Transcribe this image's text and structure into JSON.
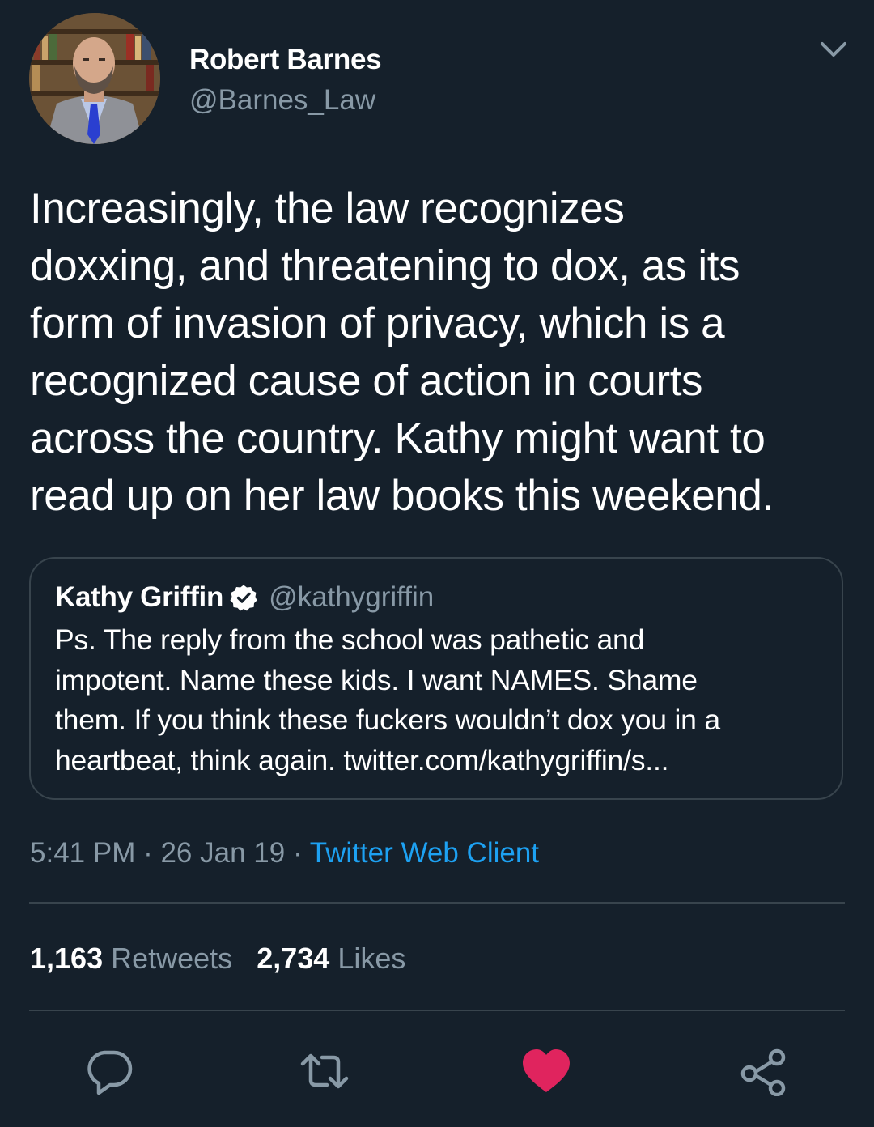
{
  "author": {
    "name": "Robert Barnes",
    "handle": "@Barnes_Law"
  },
  "tweet": {
    "text": "Increasingly, the law recognizes\ndoxxing, and threatening to dox, as its\nform of invasion of privacy, which is a\nrecognized cause of action in courts\nacross the country. Kathy might want to\nread up on her law books this weekend."
  },
  "quote": {
    "name": "Kathy Griffin",
    "handle": "@kathygriffin",
    "text": "Ps. The reply from the school was pathetic and\nimpotent. Name these kids. I want NAMES. Shame\nthem. If you think these fuckers wouldn’t dox you in a\nheartbeat, think again. twitter.com/kathygriffin/s..."
  },
  "meta": {
    "time": "5:41 PM",
    "sep1": " · ",
    "date": "26 Jan 19",
    "sep2": " · ",
    "source": "Twitter Web Client"
  },
  "stats": {
    "retweets_count": "1,163",
    "retweets_label": "Retweets",
    "likes_count": "2,734",
    "likes_label": "Likes"
  },
  "icons": {
    "reply": "reply-icon",
    "retweet": "retweet-icon",
    "like": "heart-icon",
    "share": "share-icon",
    "verified": "verified-badge-icon",
    "more": "chevron-down-icon"
  },
  "colors": {
    "background": "#15202b",
    "secondary_text": "#8899a6",
    "link": "#1da1f2",
    "like_active": "#e0245e",
    "border": "#38444d"
  }
}
